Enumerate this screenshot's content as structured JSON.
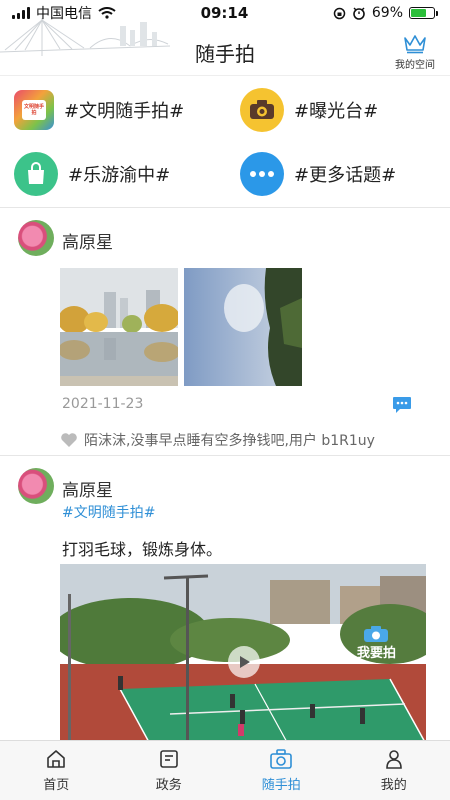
{
  "status_bar": {
    "carrier": "中国电信",
    "time": "09:14",
    "battery_percent": "69%",
    "battery_level": 0.69
  },
  "header": {
    "title": "随手拍",
    "my_space_label": "我的空间"
  },
  "topics": [
    {
      "label": "#文明随手拍#",
      "icon": "civility-camera-icon",
      "icon_text": "文明随手拍"
    },
    {
      "label": "#曝光台#",
      "icon": "exposure-camera-icon"
    },
    {
      "label": "#乐游渝中#",
      "icon": "shopping-bag-icon"
    },
    {
      "label": "#更多话题#",
      "icon": "more-dots-icon"
    }
  ],
  "posts": [
    {
      "author": "高原星",
      "date": "2021-11-23",
      "likes_text": "陌沫沫,没事早点睡有空多挣钱吧,用户 b1R1uy"
    },
    {
      "author": "高原星",
      "hashtag": "#文明随手拍#",
      "text": "打羽毛球，锻炼身体。",
      "video_badge": "我要拍"
    }
  ],
  "tabbar": [
    {
      "label": "首页",
      "icon": "home-icon"
    },
    {
      "label": "政务",
      "icon": "government-affairs-icon"
    },
    {
      "label": "随手拍",
      "icon": "snapshot-camera-icon",
      "active": true
    },
    {
      "label": "我的",
      "icon": "profile-icon"
    }
  ],
  "colors": {
    "accent": "#2f8fd6",
    "topic_green": "#3cc38a",
    "topic_blue": "#2b98e8",
    "topic_yellow": "#f5c330"
  }
}
